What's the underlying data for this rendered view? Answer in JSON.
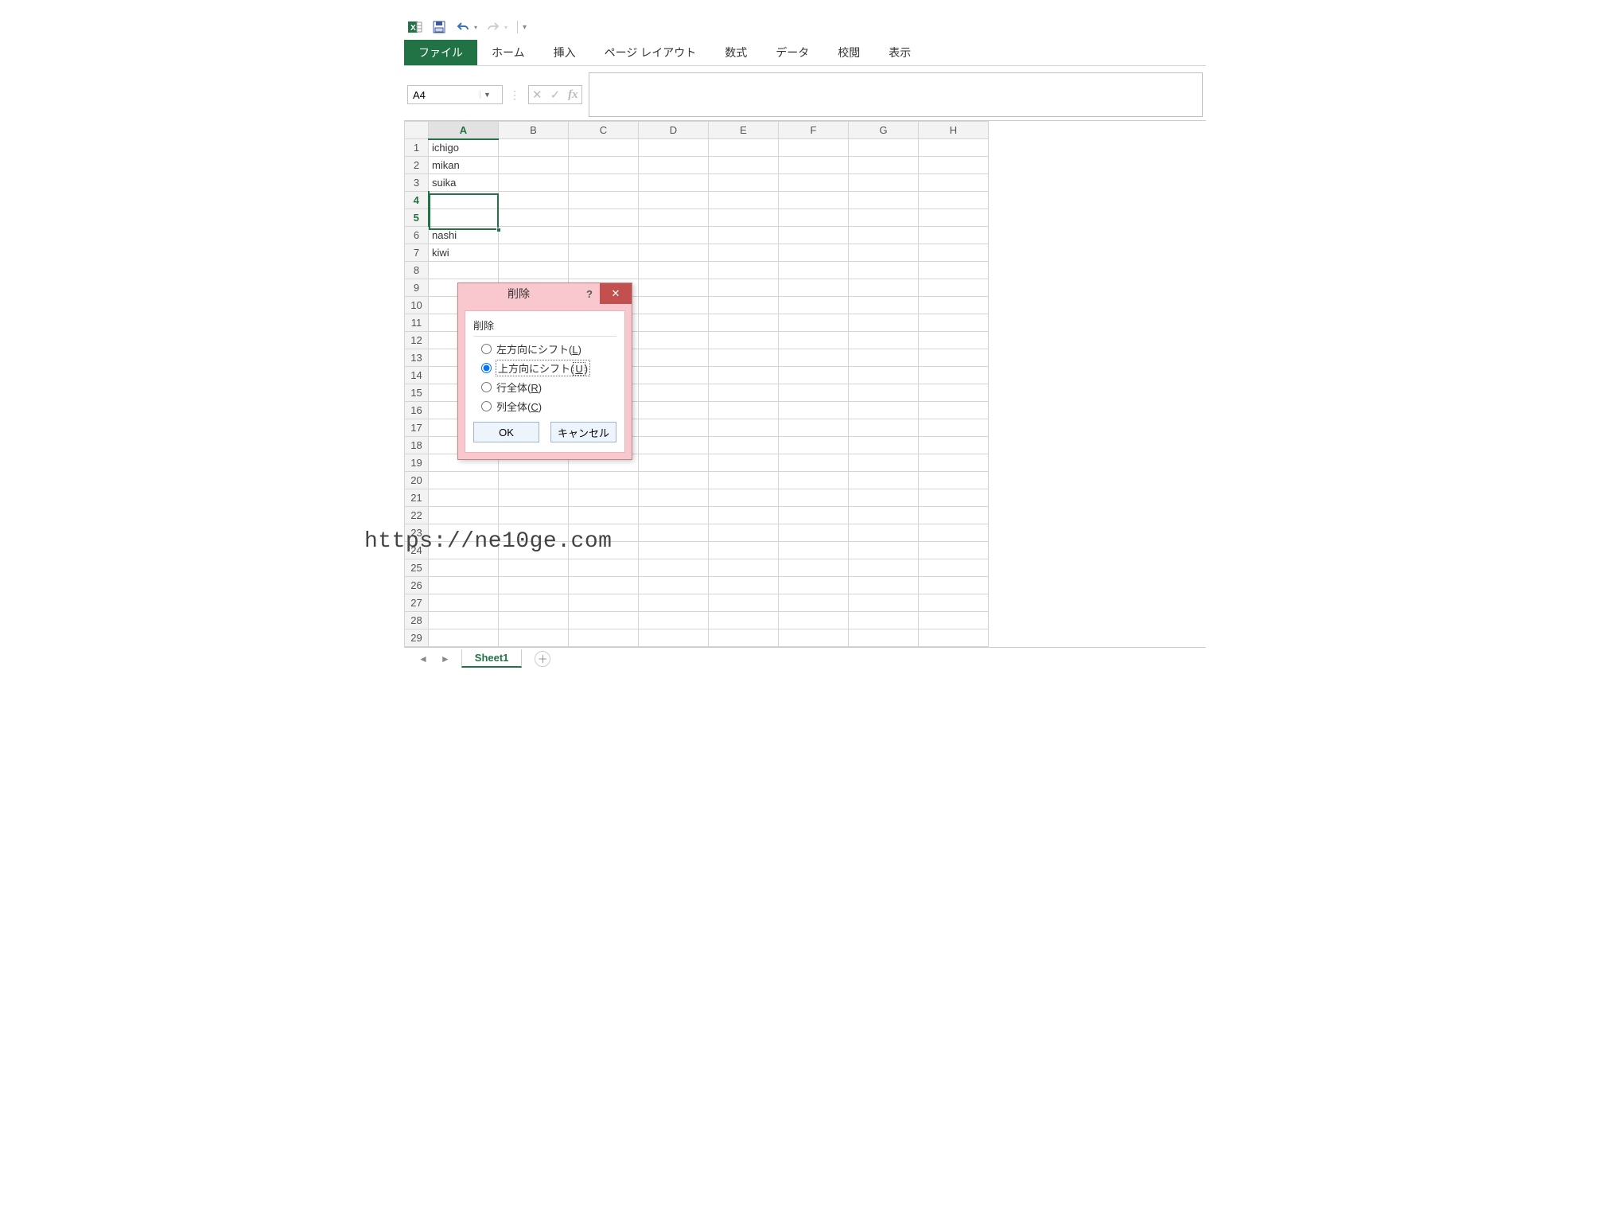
{
  "qat": {
    "excel_icon": "excel-icon",
    "save_icon": "save-icon",
    "undo_icon": "undo-icon",
    "redo_icon": "redo-icon"
  },
  "ribbon": {
    "tabs": [
      "ファイル",
      "ホーム",
      "挿入",
      "ページ レイアウト",
      "数式",
      "データ",
      "校閲",
      "表示"
    ],
    "active_index": 0
  },
  "name_box": {
    "value": "A4"
  },
  "formula_bar": {
    "fx_label": "fx",
    "value": ""
  },
  "columns": [
    "A",
    "B",
    "C",
    "D",
    "E",
    "F",
    "G",
    "H"
  ],
  "row_count": 29,
  "cells": {
    "A1": "ichigo",
    "A2": "mikan",
    "A3": "suika",
    "A4": "",
    "A5": "",
    "A6": "nashi",
    "A7": "kiwi"
  },
  "selection": {
    "col": "A",
    "rows": [
      4,
      5
    ],
    "active_row": 4
  },
  "dialog": {
    "title": "削除",
    "group_label": "削除",
    "options": [
      {
        "label_pre": "左方向にシフト(",
        "hotkey": "L",
        "label_post": ")"
      },
      {
        "label_pre": "上方向にシフト(",
        "hotkey": "U",
        "label_post": ")"
      },
      {
        "label_pre": "行全体(",
        "hotkey": "R",
        "label_post": ")"
      },
      {
        "label_pre": "列全体(",
        "hotkey": "C",
        "label_post": ")"
      }
    ],
    "selected_index": 1,
    "ok": "OK",
    "cancel": "キャンセル",
    "help": "?",
    "close": "✕"
  },
  "sheet_tabs": {
    "active": "Sheet1"
  },
  "watermark": "https://ne10ge.com"
}
